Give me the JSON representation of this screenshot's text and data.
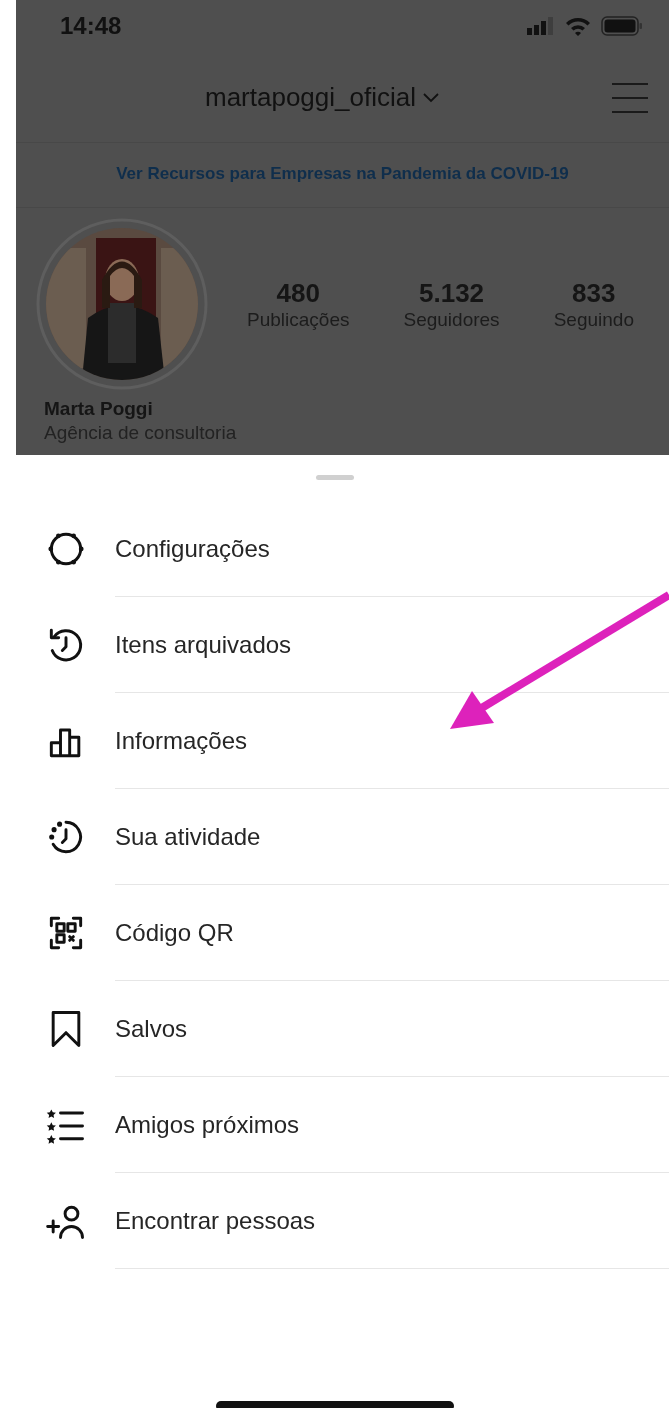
{
  "status_bar": {
    "time": "14:48"
  },
  "header": {
    "username": "martapoggi_oficial"
  },
  "banner": {
    "text": "Ver Recursos para Empresas na Pandemia da COVID-19"
  },
  "profile": {
    "stats": [
      {
        "value": "480",
        "label": "Publicações"
      },
      {
        "value": "5.132",
        "label": "Seguidores"
      },
      {
        "value": "833",
        "label": "Seguindo"
      }
    ],
    "name": "Marta Poggi",
    "category": "Agência de consultoria"
  },
  "menu": {
    "items": [
      {
        "label": "Configurações"
      },
      {
        "label": "Itens arquivados"
      },
      {
        "label": "Informações"
      },
      {
        "label": "Sua atividade"
      },
      {
        "label": "Código QR"
      },
      {
        "label": "Salvos"
      },
      {
        "label": "Amigos próximos"
      },
      {
        "label": "Encontrar pessoas"
      }
    ]
  }
}
